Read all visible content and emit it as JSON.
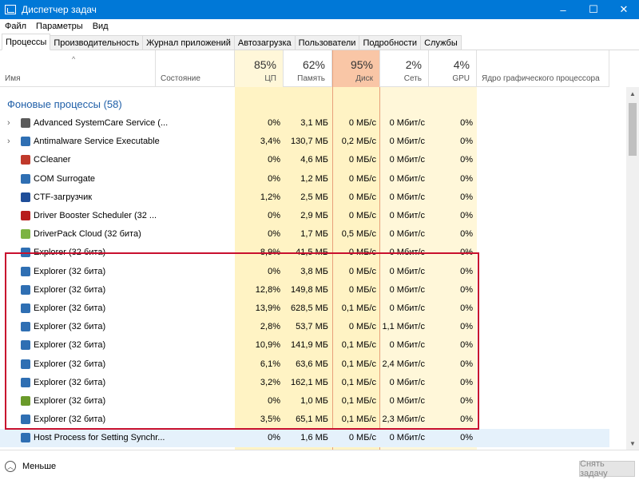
{
  "window": {
    "title": "Диспетчер задач",
    "minimize": "–",
    "maximize": "☐",
    "close": "✕"
  },
  "menu": [
    "Файл",
    "Параметры",
    "Вид"
  ],
  "tabs": [
    "Процессы",
    "Производительность",
    "Журнал приложений",
    "Автозагрузка",
    "Пользователи",
    "Подробности",
    "Службы"
  ],
  "columns": {
    "name": "Имя",
    "status": "Состояние",
    "cpu": {
      "pct": "85%",
      "label": "ЦП"
    },
    "memory": {
      "pct": "62%",
      "label": "Память"
    },
    "disk": {
      "pct": "95%",
      "label": "Диск"
    },
    "network": {
      "pct": "2%",
      "label": "Сеть"
    },
    "gpu": {
      "pct": "4%",
      "label": "GPU"
    },
    "gpu_engine": "Ядро графического процессора"
  },
  "group_title": "Фоновые процессы (58)",
  "rows": [
    {
      "name": "Advanced SystemCare Service (...",
      "expand": "›",
      "icon": "advanced-systemcare-icon",
      "color": "#5a5a5a",
      "cpu": "0%",
      "mem": "3,1 МБ",
      "disk": "0 МБ/с",
      "net": "0 Мбит/с",
      "gpu": "0%"
    },
    {
      "name": "Antimalware Service Executable",
      "expand": "›",
      "icon": "antimalware-icon",
      "color": "#2f6fb3",
      "cpu": "3,4%",
      "mem": "130,7 МБ",
      "disk": "0,2 МБ/с",
      "net": "0 Мбит/с",
      "gpu": "0%"
    },
    {
      "name": "CCleaner",
      "expand": "",
      "icon": "ccleaner-icon",
      "color": "#c0392b",
      "cpu": "0%",
      "mem": "4,6 МБ",
      "disk": "0 МБ/с",
      "net": "0 Мбит/с",
      "gpu": "0%"
    },
    {
      "name": "COM Surrogate",
      "expand": "",
      "icon": "com-surrogate-icon",
      "color": "#2f6fb3",
      "cpu": "0%",
      "mem": "1,2 МБ",
      "disk": "0 МБ/с",
      "net": "0 Мбит/с",
      "gpu": "0%"
    },
    {
      "name": "CTF-загрузчик",
      "expand": "",
      "icon": "ctf-loader-icon",
      "color": "#1f4e99",
      "cpu": "1,2%",
      "mem": "2,5 МБ",
      "disk": "0 МБ/с",
      "net": "0 Мбит/с",
      "gpu": "0%"
    },
    {
      "name": "Driver Booster Scheduler (32 ...",
      "expand": "",
      "icon": "driver-booster-icon",
      "color": "#b71c1c",
      "cpu": "0%",
      "mem": "2,9 МБ",
      "disk": "0 МБ/с",
      "net": "0 Мбит/с",
      "gpu": "0%"
    },
    {
      "name": "DriverPack Cloud (32 бита)",
      "expand": "",
      "icon": "driverpack-icon",
      "color": "#7cb342",
      "cpu": "0%",
      "mem": "1,7 МБ",
      "disk": "0,5 МБ/с",
      "net": "0 Мбит/с",
      "gpu": "0%"
    },
    {
      "name": "Explorer (32 бита)",
      "expand": "",
      "icon": "explorer-icon",
      "color": "#2f6fb3",
      "cpu": "8,9%",
      "mem": "41,5 МБ",
      "disk": "0 МБ/с",
      "net": "0 Мбит/с",
      "gpu": "0%"
    },
    {
      "name": "Explorer (32 бита)",
      "expand": "",
      "icon": "explorer-icon",
      "color": "#2f6fb3",
      "cpu": "0%",
      "mem": "3,8 МБ",
      "disk": "0 МБ/с",
      "net": "0 Мбит/с",
      "gpu": "0%"
    },
    {
      "name": "Explorer (32 бита)",
      "expand": "",
      "icon": "explorer-icon",
      "color": "#2f6fb3",
      "cpu": "12,8%",
      "mem": "149,8 МБ",
      "disk": "0 МБ/с",
      "net": "0 Мбит/с",
      "gpu": "0%"
    },
    {
      "name": "Explorer (32 бита)",
      "expand": "",
      "icon": "explorer-icon",
      "color": "#2f6fb3",
      "cpu": "13,9%",
      "mem": "628,5 МБ",
      "disk": "0,1 МБ/с",
      "net": "0 Мбит/с",
      "gpu": "0%"
    },
    {
      "name": "Explorer (32 бита)",
      "expand": "",
      "icon": "explorer-icon",
      "color": "#2f6fb3",
      "cpu": "2,8%",
      "mem": "53,7 МБ",
      "disk": "0 МБ/с",
      "net": "1,1 Мбит/с",
      "gpu": "0%"
    },
    {
      "name": "Explorer (32 бита)",
      "expand": "",
      "icon": "explorer-icon",
      "color": "#2f6fb3",
      "cpu": "10,9%",
      "mem": "141,9 МБ",
      "disk": "0,1 МБ/с",
      "net": "0 Мбит/с",
      "gpu": "0%"
    },
    {
      "name": "Explorer (32 бита)",
      "expand": "",
      "icon": "explorer-icon",
      "color": "#2f6fb3",
      "cpu": "6,1%",
      "mem": "63,6 МБ",
      "disk": "0,1 МБ/с",
      "net": "2,4 Мбит/с",
      "gpu": "0%"
    },
    {
      "name": "Explorer (32 бита)",
      "expand": "",
      "icon": "explorer-icon",
      "color": "#2f6fb3",
      "cpu": "3,2%",
      "mem": "162,1 МБ",
      "disk": "0,1 МБ/с",
      "net": "0 Мбит/с",
      "gpu": "0%"
    },
    {
      "name": "Explorer (32 бита)",
      "expand": "",
      "icon": "explorer-green-icon",
      "color": "#6a9a2a",
      "cpu": "0%",
      "mem": "1,0 МБ",
      "disk": "0,1 МБ/с",
      "net": "0 Мбит/с",
      "gpu": "0%"
    },
    {
      "name": "Explorer (32 бита)",
      "expand": "",
      "icon": "explorer-icon",
      "color": "#2f6fb3",
      "cpu": "3,5%",
      "mem": "65,1 МБ",
      "disk": "0,1 МБ/с",
      "net": "2,3 Мбит/с",
      "gpu": "0%"
    },
    {
      "name": "Host Process for Setting Synchr...",
      "expand": "",
      "icon": "host-process-icon",
      "color": "#2f6fb3",
      "cpu": "0%",
      "mem": "1,6 МБ",
      "disk": "0 МБ/с",
      "net": "0 Мбит/с",
      "gpu": "0%"
    }
  ],
  "footer": {
    "less": "Меньше",
    "end_task": "Снять задачу"
  },
  "colors": {
    "titlebar": "#0078d7",
    "heat_light": "#fff7d9",
    "heat_mid": "#ffefb3",
    "disk_header": "#f9c6a6",
    "highlight_border": "#c8102e"
  }
}
